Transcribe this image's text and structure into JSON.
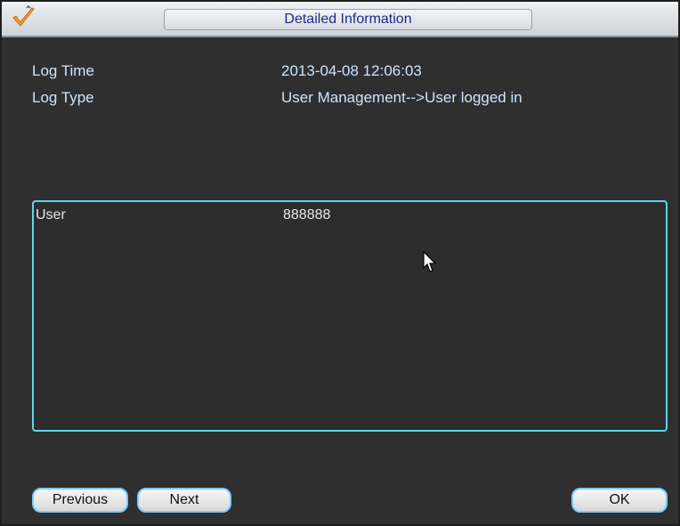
{
  "window": {
    "title": "Detailed Information"
  },
  "fields": {
    "log_time_label": "Log Time",
    "log_time_value": "2013-04-08 12:06:03",
    "log_type_label": "Log Type",
    "log_type_value": "User Management-->User logged in"
  },
  "detail": {
    "rows": [
      {
        "key": "User",
        "value": "888888"
      }
    ]
  },
  "buttons": {
    "previous": "Previous",
    "next": "Next",
    "ok": "OK"
  },
  "colors": {
    "title_text": "#1b2b8c",
    "label_text": "#cfe3ff",
    "box_border": "#5bd6e6",
    "button_border": "#7fc9ff",
    "background": "#2f2f2f"
  },
  "icons": {
    "logo": "checkmark-logo-icon",
    "cursor": "mouse-pointer-icon"
  }
}
